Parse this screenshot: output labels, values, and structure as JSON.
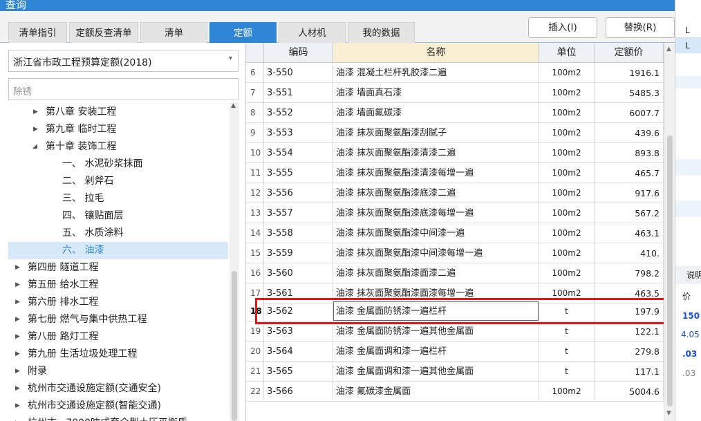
{
  "window": {
    "title": "查询"
  },
  "tabs": [
    {
      "label": "清单指引",
      "active": false
    },
    {
      "label": "定额反查清单",
      "active": false
    },
    {
      "label": "清单",
      "active": false
    },
    {
      "label": "定额",
      "active": true
    },
    {
      "label": "人材机",
      "active": false
    },
    {
      "label": "我的数据",
      "active": false
    }
  ],
  "buttons": {
    "insert": "插入(I)",
    "replace": "替换(R)"
  },
  "library": {
    "selected": "浙江省市政工程预算定额(2018)"
  },
  "search": {
    "value": "除锈"
  },
  "tree": [
    {
      "label": "第八章 安装工程",
      "level": 1,
      "arrow": "right",
      "selected": false
    },
    {
      "label": "第九章 临时工程",
      "level": 1,
      "arrow": "right",
      "selected": false
    },
    {
      "label": "第十章 装饰工程",
      "level": 1,
      "arrow": "down",
      "selected": false
    },
    {
      "label": "一、 水泥砂浆抹面",
      "level": 2,
      "arrow": "",
      "selected": false
    },
    {
      "label": "二、 剁斧石",
      "level": 2,
      "arrow": "",
      "selected": false
    },
    {
      "label": "三、 拉毛",
      "level": 2,
      "arrow": "",
      "selected": false
    },
    {
      "label": "四、 镶贴面层",
      "level": 2,
      "arrow": "",
      "selected": false
    },
    {
      "label": "五、 水质涂料",
      "level": 2,
      "arrow": "",
      "selected": false
    },
    {
      "label": "六、 油漆",
      "level": 2,
      "arrow": "",
      "selected": true
    },
    {
      "label": "第四册 隧道工程",
      "level": 0,
      "arrow": "right",
      "selected": false
    },
    {
      "label": "第五册 给水工程",
      "level": 0,
      "arrow": "right",
      "selected": false
    },
    {
      "label": "第六册 排水工程",
      "level": 0,
      "arrow": "right",
      "selected": false
    },
    {
      "label": "第七册 燃气与集中供热工程",
      "level": 0,
      "arrow": "right",
      "selected": false
    },
    {
      "label": "第八册 路灯工程",
      "level": 0,
      "arrow": "right",
      "selected": false
    },
    {
      "label": "第九册 生活垃圾处理工程",
      "level": 0,
      "arrow": "right",
      "selected": false
    },
    {
      "label": "附录",
      "level": 0,
      "arrow": "right",
      "selected": false
    },
    {
      "label": "杭州市交通设施定额(交通安全)",
      "level": 0,
      "arrow": "right",
      "selected": false
    },
    {
      "label": "杭州市交通设施定额(智能交通)",
      "level": 0,
      "arrow": "right",
      "selected": false
    },
    {
      "label": "杭州市...7000吨成套全型土压平衡盾...",
      "level": 0,
      "arrow": "right",
      "selected": false
    }
  ],
  "grid": {
    "headers": {
      "code": "编码",
      "name": "名称",
      "unit": "单位",
      "price": "定额价"
    },
    "rows": [
      {
        "idx": "6",
        "code": "3-550",
        "name": "油漆 混凝土栏杆乳胶漆二遍",
        "unit": "100m2",
        "price": "1916.1"
      },
      {
        "idx": "7",
        "code": "3-551",
        "name": "油漆 墙面真石漆",
        "unit": "100m2",
        "price": "5485.3"
      },
      {
        "idx": "8",
        "code": "3-552",
        "name": "油漆 墙面氟碳漆",
        "unit": "100m2",
        "price": "6007.7"
      },
      {
        "idx": "9",
        "code": "3-553",
        "name": "油漆 抹灰面聚氨酯漆刮腻子",
        "unit": "100m2",
        "price": "439.6"
      },
      {
        "idx": "10",
        "code": "3-554",
        "name": "油漆 抹灰面聚氨酯漆清漆二遍",
        "unit": "100m2",
        "price": "893.8"
      },
      {
        "idx": "11",
        "code": "3-555",
        "name": "油漆 抹灰面聚氨酯漆清漆每增一遍",
        "unit": "100m2",
        "price": "465.7"
      },
      {
        "idx": "12",
        "code": "3-556",
        "name": "油漆 抹灰面聚氨酯漆底漆二遍",
        "unit": "100m2",
        "price": "917.6"
      },
      {
        "idx": "13",
        "code": "3-557",
        "name": "油漆 抹灰面聚氨酯漆底漆每增一遍",
        "unit": "100m2",
        "price": "567.2"
      },
      {
        "idx": "14",
        "code": "3-558",
        "name": "油漆 抹灰面聚氨酯漆中间漆一遍",
        "unit": "100m2",
        "price": "463.1"
      },
      {
        "idx": "15",
        "code": "3-559",
        "name": "油漆 抹灰面聚氨酯漆中间漆每增一遍",
        "unit": "100m2",
        "price": "410."
      },
      {
        "idx": "16",
        "code": "3-560",
        "name": "油漆 抹灰面聚氨酯漆面漆二遍",
        "unit": "100m2",
        "price": "798.2"
      },
      {
        "idx": "17",
        "code": "3-561",
        "name": "油漆 抹灰面聚氨酯漆面漆每增一遍",
        "unit": "100m2",
        "price": "463.5"
      },
      {
        "idx": "18",
        "code": "3-562",
        "name": "油漆 金属面防锈漆一遍栏杆",
        "unit": "t",
        "price": "197.9",
        "selected": true
      },
      {
        "idx": "19",
        "code": "3-563",
        "name": "油漆 金属面防锈漆一遍其他金属面",
        "unit": "t",
        "price": "122.1"
      },
      {
        "idx": "20",
        "code": "3-564",
        "name": "油漆 金属面调和漆一遍栏杆",
        "unit": "t",
        "price": "279.8"
      },
      {
        "idx": "21",
        "code": "3-565",
        "name": "油漆 金属面调和漆一遍其他金属面",
        "unit": "t",
        "price": "117.1"
      },
      {
        "idx": "22",
        "code": "3-566",
        "name": "油漆 氟碳漆金属面",
        "unit": "100m2",
        "price": "5004.6"
      }
    ]
  },
  "background_window": {
    "texts": [
      "L",
      "L",
      "说明",
      "价",
      "150",
      "4.05",
      ".03",
      ".03"
    ]
  },
  "colors": {
    "accent": "#2f86d6",
    "highlight_box": "#e8161a",
    "selected_tree_bg": "#d7e8f8"
  }
}
